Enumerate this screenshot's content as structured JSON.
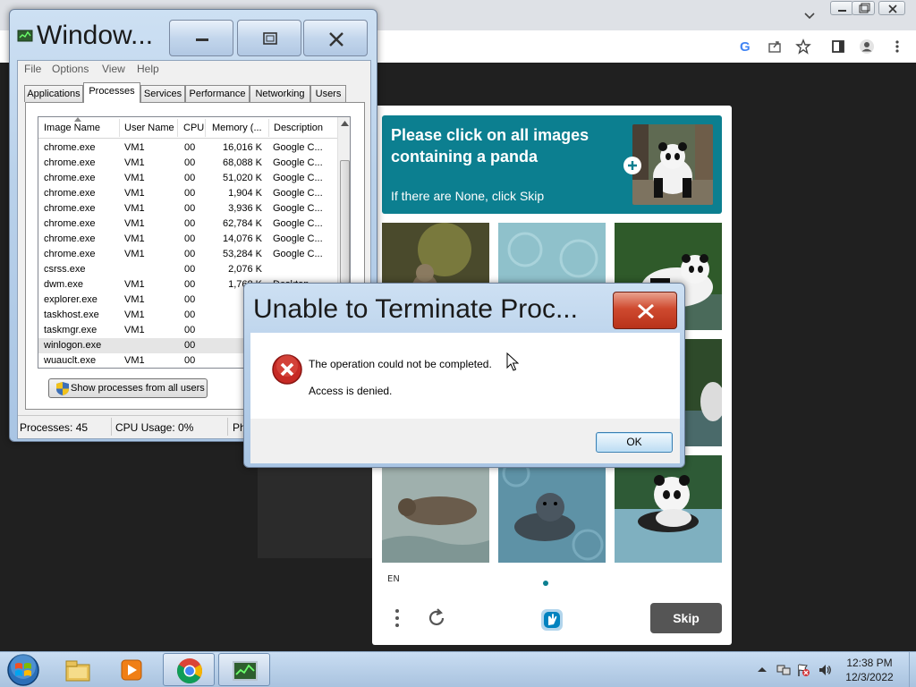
{
  "captcha": {
    "prompt": "Please click on all images containing a panda",
    "sub": "If there are None, click Skip",
    "language": "EN",
    "skip_label": "Skip",
    "accent": "#0c7f90"
  },
  "taskmgr": {
    "title": "Window...",
    "menu": [
      "File",
      "Options",
      "View",
      "Help"
    ],
    "tabs": [
      "Applications",
      "Processes",
      "Services",
      "Performance",
      "Networking",
      "Users"
    ],
    "active_tab": "Processes",
    "columns": [
      "Image Name",
      "User Name",
      "CPU",
      "Memory (...",
      "Description"
    ],
    "processes": [
      {
        "name": "chrome.exe",
        "user": "VM1",
        "cpu": "00",
        "mem": "16,016 K",
        "desc": "Google C..."
      },
      {
        "name": "chrome.exe",
        "user": "VM1",
        "cpu": "00",
        "mem": "68,088 K",
        "desc": "Google C..."
      },
      {
        "name": "chrome.exe",
        "user": "VM1",
        "cpu": "00",
        "mem": "51,020 K",
        "desc": "Google C..."
      },
      {
        "name": "chrome.exe",
        "user": "VM1",
        "cpu": "00",
        "mem": "1,904 K",
        "desc": "Google C..."
      },
      {
        "name": "chrome.exe",
        "user": "VM1",
        "cpu": "00",
        "mem": "3,936 K",
        "desc": "Google C..."
      },
      {
        "name": "chrome.exe",
        "user": "VM1",
        "cpu": "00",
        "mem": "62,784 K",
        "desc": "Google C..."
      },
      {
        "name": "chrome.exe",
        "user": "VM1",
        "cpu": "00",
        "mem": "14,076 K",
        "desc": "Google C..."
      },
      {
        "name": "chrome.exe",
        "user": "VM1",
        "cpu": "00",
        "mem": "53,284 K",
        "desc": "Google C..."
      },
      {
        "name": "csrss.exe",
        "user": "",
        "cpu": "00",
        "mem": "2,076 K",
        "desc": ""
      },
      {
        "name": "dwm.exe",
        "user": "VM1",
        "cpu": "00",
        "mem": "1,768 K",
        "desc": "Desktop..."
      },
      {
        "name": "explorer.exe",
        "user": "VM1",
        "cpu": "00",
        "mem": "26,1",
        "desc": ""
      },
      {
        "name": "taskhost.exe",
        "user": "VM1",
        "cpu": "00",
        "mem": "4,0",
        "desc": ""
      },
      {
        "name": "taskmgr.exe",
        "user": "VM1",
        "cpu": "00",
        "mem": "3,0",
        "desc": ""
      },
      {
        "name": "winlogon.exe",
        "user": "",
        "cpu": "00",
        "mem": "3,2",
        "desc": ""
      },
      {
        "name": "wuauclt.exe",
        "user": "VM1",
        "cpu": "00",
        "mem": "1,9",
        "desc": ""
      }
    ],
    "show_all_label": "Show processes from all users",
    "status_processes": "Processes: 45",
    "status_cpu": "CPU Usage: 0%",
    "status_phys": "Ph"
  },
  "error_dialog": {
    "title": "Unable to Terminate Proc...",
    "message": "The operation could not be completed.",
    "detail": "Access is denied.",
    "ok_label": "OK"
  },
  "taskbar": {
    "time": "12:38 PM",
    "date": "12/3/2022"
  }
}
